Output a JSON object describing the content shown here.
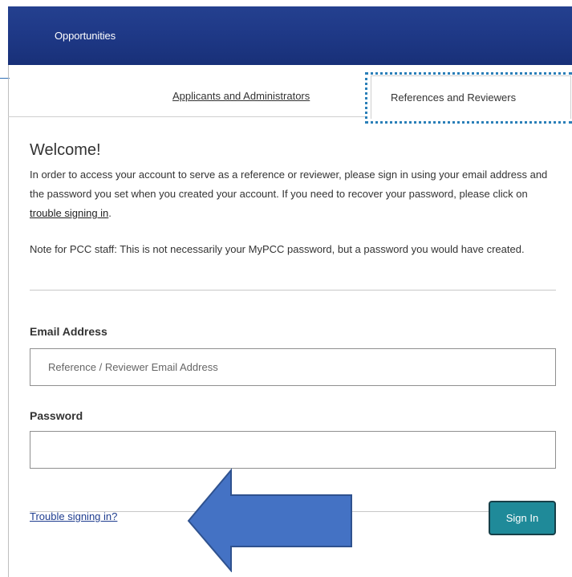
{
  "header": {
    "title": "Opportunities"
  },
  "tabs": {
    "inactive_label": "Applicants and Administrators",
    "active_label": "References and Reviewers"
  },
  "content": {
    "welcome": "Welcome!",
    "para1_before_link": "In order to access your account to serve as a reference or reviewer, please sign in using your email address and the password you set when you created your account. If you need to recover your password, please click on ",
    "para1_link": "trouble signing in",
    "para1_after_link": ".",
    "para2": "Note for PCC staff: This is not necessarily your MyPCC password, but a password you would have created."
  },
  "form": {
    "email_label": "Email Address",
    "email_placeholder": "Reference / Reviewer Email Address",
    "email_value": "",
    "password_label": "Password",
    "password_value": "",
    "trouble_link": "Trouble signing in?",
    "signin_label": "Sign In"
  },
  "colors": {
    "header_bg": "#1f3987",
    "signin_bg": "#1f8a99",
    "arrow_fill": "#4472c4",
    "arrow_stroke": "#2f528f",
    "focus_outline": "#2a7fb8"
  },
  "annotation": {
    "icon": "arrow-left-icon"
  }
}
